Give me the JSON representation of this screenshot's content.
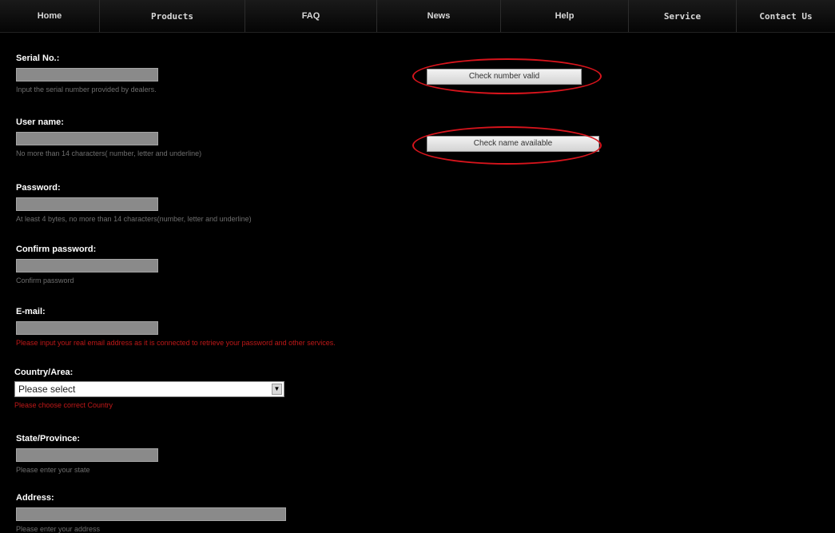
{
  "nav": {
    "items": [
      "Home",
      "Products",
      "FAQ",
      "News",
      "Help",
      "Service",
      "Contact Us"
    ]
  },
  "form": {
    "serial": {
      "label": "Serial No.:",
      "hint": "Input the serial number provided by dealers."
    },
    "username": {
      "label": "User name:",
      "hint": "No more than 14 characters( number, letter and underline)"
    },
    "password": {
      "label": "Password:",
      "hint": "At least 4 bytes, no more than 14 characters(number, letter and underline)"
    },
    "confirm": {
      "label": "Confirm password:",
      "hint": "Confirm password"
    },
    "email": {
      "label": "E-mail:",
      "hint": "Please input your real email address as it is connected to retrieve your password and other services."
    },
    "country": {
      "label": "Country/Area:",
      "selected": "Please select",
      "hint": "Please choose correct Country"
    },
    "state": {
      "label": "State/Province:",
      "hint": "Please enter your state"
    },
    "address": {
      "label": "Address:",
      "hint": "Please enter your address"
    }
  },
  "buttons": {
    "check_number": "Check number valid",
    "check_name": "Check name available"
  },
  "colors": {
    "background": "#000000",
    "highlight_circle": "#d8141c",
    "warning_text": "#c01818"
  }
}
